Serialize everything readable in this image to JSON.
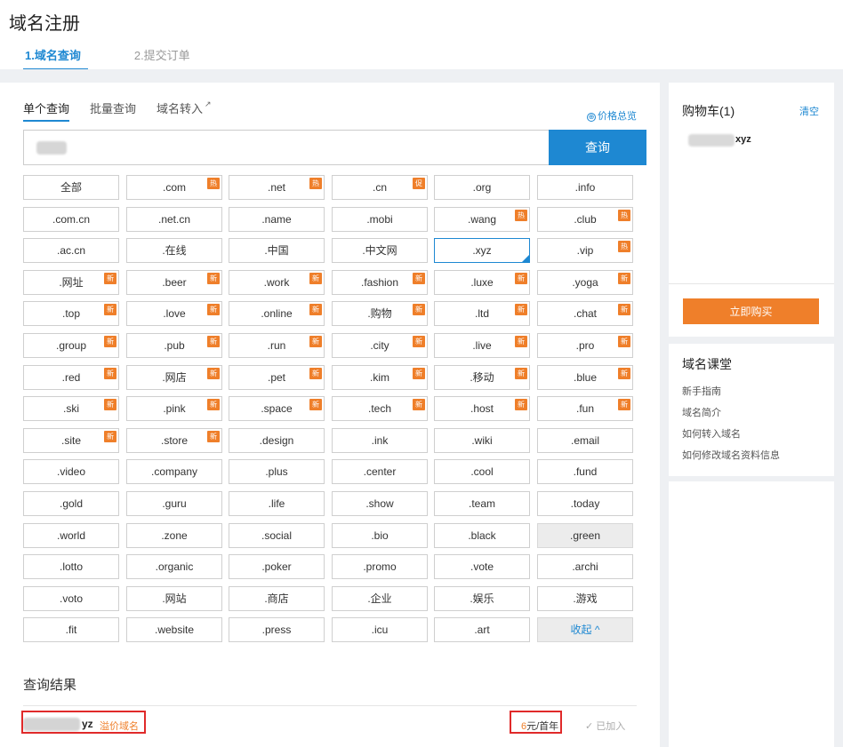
{
  "header": {
    "title": "域名注册",
    "steps": [
      "1.域名查询",
      "2.提交订单"
    ]
  },
  "query": {
    "tabs": [
      "单个查询",
      "批量查询",
      "域名转入"
    ],
    "external_icon": "↗",
    "price_overview": "价格总览",
    "price_overview_icon": "⊕",
    "search_button": "查询"
  },
  "tlds": [
    {
      "label": "全部"
    },
    {
      "label": ".com",
      "tag": "热"
    },
    {
      "label": ".net",
      "tag": "热"
    },
    {
      "label": ".cn",
      "tag": "促"
    },
    {
      "label": ".org"
    },
    {
      "label": ".info"
    },
    {
      "label": ".com.cn"
    },
    {
      "label": ".net.cn"
    },
    {
      "label": ".name"
    },
    {
      "label": ".mobi"
    },
    {
      "label": ".wang",
      "tag": "热"
    },
    {
      "label": ".club",
      "tag": "热"
    },
    {
      "label": ".ac.cn"
    },
    {
      "label": ".在线"
    },
    {
      "label": ".中国"
    },
    {
      "label": ".中文网"
    },
    {
      "label": ".xyz",
      "state": "selected"
    },
    {
      "label": ".vip",
      "tag": "热"
    },
    {
      "label": ".网址",
      "tag": "新"
    },
    {
      "label": ".beer",
      "tag": "新"
    },
    {
      "label": ".work",
      "tag": "新"
    },
    {
      "label": ".fashion",
      "tag": "新"
    },
    {
      "label": ".luxe",
      "tag": "新"
    },
    {
      "label": ".yoga",
      "tag": "新"
    },
    {
      "label": ".top",
      "tag": "新"
    },
    {
      "label": ".love",
      "tag": "新"
    },
    {
      "label": ".online",
      "tag": "新"
    },
    {
      "label": ".购物",
      "tag": "新"
    },
    {
      "label": ".ltd",
      "tag": "新"
    },
    {
      "label": ".chat",
      "tag": "新"
    },
    {
      "label": ".group",
      "tag": "新"
    },
    {
      "label": ".pub",
      "tag": "新"
    },
    {
      "label": ".run",
      "tag": "新"
    },
    {
      "label": ".city",
      "tag": "新"
    },
    {
      "label": ".live",
      "tag": "新"
    },
    {
      "label": ".pro",
      "tag": "新"
    },
    {
      "label": ".red",
      "tag": "新"
    },
    {
      "label": ".网店",
      "tag": "新"
    },
    {
      "label": ".pet",
      "tag": "新"
    },
    {
      "label": ".kim",
      "tag": "新"
    },
    {
      "label": ".移动",
      "tag": "新"
    },
    {
      "label": ".blue",
      "tag": "新"
    },
    {
      "label": ".ski",
      "tag": "新"
    },
    {
      "label": ".pink",
      "tag": "新"
    },
    {
      "label": ".space",
      "tag": "新"
    },
    {
      "label": ".tech",
      "tag": "新"
    },
    {
      "label": ".host",
      "tag": "新"
    },
    {
      "label": ".fun",
      "tag": "新"
    },
    {
      "label": ".site",
      "tag": "新"
    },
    {
      "label": ".store",
      "tag": "新"
    },
    {
      "label": ".design"
    },
    {
      "label": ".ink"
    },
    {
      "label": ".wiki"
    },
    {
      "label": ".email"
    },
    {
      "label": ".video"
    },
    {
      "label": ".company"
    },
    {
      "label": ".plus"
    },
    {
      "label": ".center"
    },
    {
      "label": ".cool"
    },
    {
      "label": ".fund"
    },
    {
      "label": ".gold"
    },
    {
      "label": ".guru"
    },
    {
      "label": ".life"
    },
    {
      "label": ".show"
    },
    {
      "label": ".team"
    },
    {
      "label": ".today"
    },
    {
      "label": ".world"
    },
    {
      "label": ".zone"
    },
    {
      "label": ".social"
    },
    {
      "label": ".bio"
    },
    {
      "label": ".black"
    },
    {
      "label": ".green",
      "state": "grey"
    },
    {
      "label": ".lotto"
    },
    {
      "label": ".organic"
    },
    {
      "label": ".poker"
    },
    {
      "label": ".promo"
    },
    {
      "label": ".vote"
    },
    {
      "label": ".archi"
    },
    {
      "label": ".voto"
    },
    {
      "label": ".网站"
    },
    {
      "label": ".商店"
    },
    {
      "label": ".企业"
    },
    {
      "label": ".娱乐"
    },
    {
      "label": ".游戏"
    },
    {
      "label": ".fit"
    },
    {
      "label": ".website"
    },
    {
      "label": ".press"
    },
    {
      "label": ".icu"
    },
    {
      "label": ".art"
    },
    {
      "label": "收起 ^",
      "state": "collapse"
    }
  ],
  "result": {
    "title": "查询结果",
    "name_suffix": "yz",
    "premium_label": "溢价域名",
    "price_number": "6",
    "price_unit": "元/首年",
    "added_label": "✓ 已加入"
  },
  "sidebar": {
    "cart_title": "购物车(1)",
    "clear_label": "清空",
    "cart_item_suffix": "xyz",
    "buy_button": "立即购买",
    "course_title": "域名课堂",
    "course_links": [
      "新手指南",
      "域名简介",
      "如何转入域名",
      "如何修改域名资料信息"
    ]
  },
  "colors": {
    "accent": "#1e88d2",
    "orange": "#ef7f2a",
    "highlight_red": "#e02a2a"
  }
}
